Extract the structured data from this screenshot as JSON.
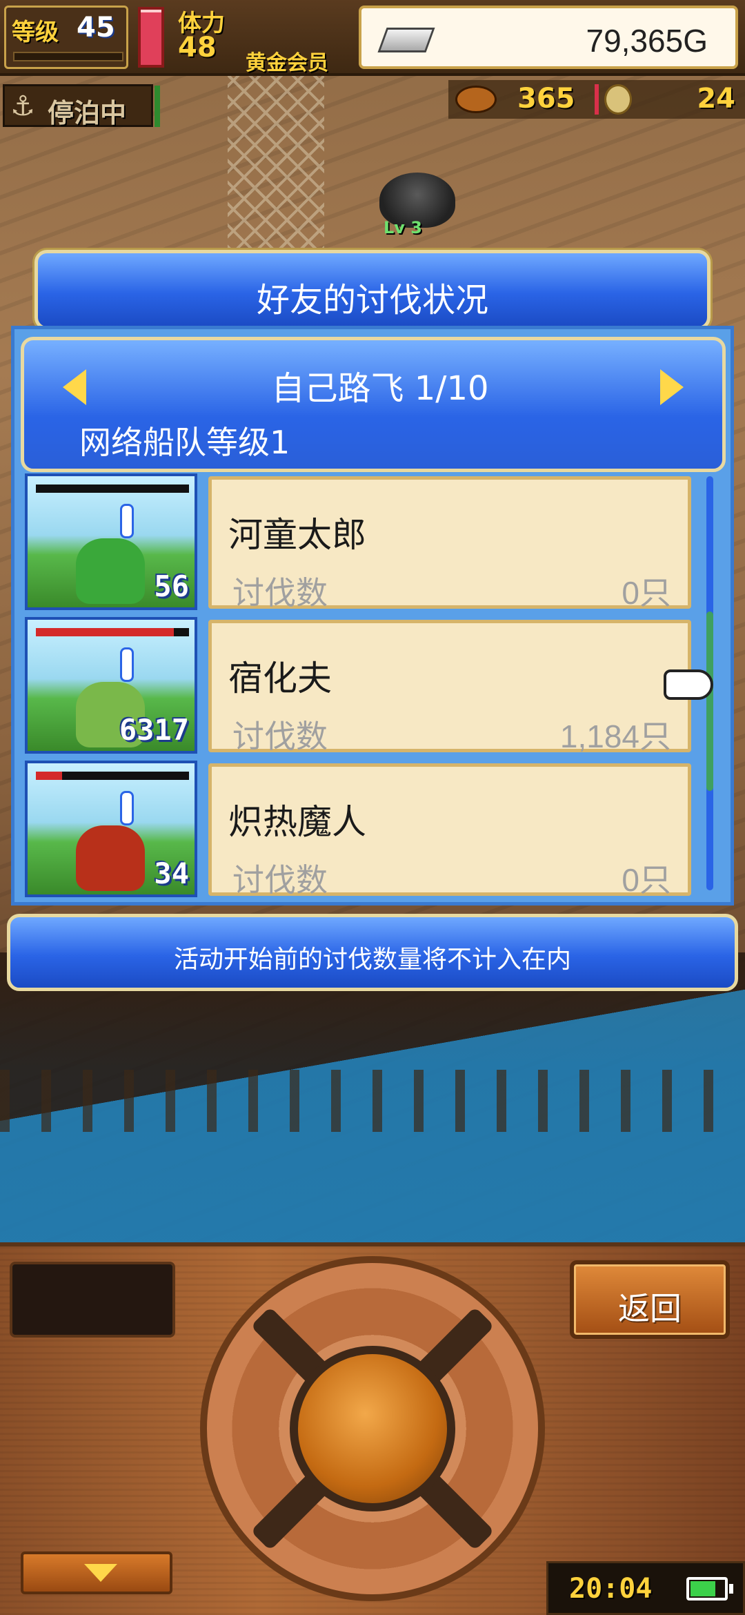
{
  "hud": {
    "level_label": "等级",
    "level_value": "45",
    "stamina_label": "体力",
    "stamina_value": "48",
    "vip_label": "黄金会员",
    "gold_value": "79,365G",
    "dock_status": "停泊中",
    "food_value": "365",
    "medal_value": "24",
    "hp_fraction": 0.95
  },
  "scene": {
    "monster_level": "Lv 3"
  },
  "dialog": {
    "title": "好友的讨伐状况",
    "friend_name": "自己路飞 1/10",
    "fleet_level": "网络船队等级1",
    "kill_label": "讨伐数",
    "notice": "活动开始前的讨伐数量将不计入在内",
    "monsters": [
      {
        "name": "河童太郎",
        "level": "56",
        "kills": "0只",
        "hp_fraction": 0.0,
        "hp_color": "#d42a2a",
        "creature_color": "#3aa83a"
      },
      {
        "name": "宿化夫",
        "level": "6317",
        "kills": "1,184只",
        "hp_fraction": 0.9,
        "hp_color": "#d42a2a",
        "creature_color": "#7ab84a"
      },
      {
        "name": "炽热魔人",
        "level": "34",
        "kills": "0只",
        "hp_fraction": 0.17,
        "hp_color": "#d42a2a",
        "creature_color": "#b8301a"
      }
    ]
  },
  "panel": {
    "back_label": "返回",
    "clock": "20:04",
    "battery_fraction": 0.7
  },
  "colors": {
    "dialog_blue": "#2a64e6",
    "card_cream": "#f7e8c4",
    "gold_text": "#ffd23c"
  }
}
